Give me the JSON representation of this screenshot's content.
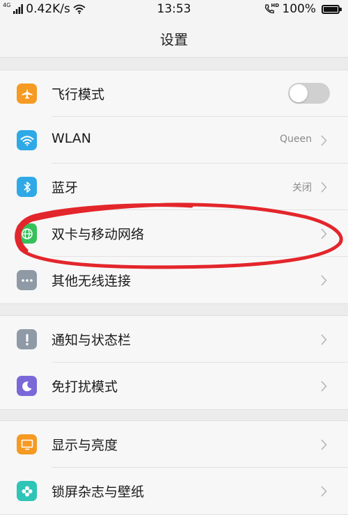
{
  "status_bar": {
    "network_speed": "0.42K/s",
    "signal_tag": "4G",
    "time": "13:53",
    "hd_tag": "HD",
    "battery": "100%",
    "battery_level": 1.0
  },
  "page": {
    "title": "设置"
  },
  "sections": [
    {
      "items": [
        {
          "key": "airplane",
          "label": "飞行模式",
          "icon": "airplane-icon",
          "icon_color": "#f59a23",
          "control": "toggle",
          "toggle_on": false
        },
        {
          "key": "wlan",
          "label": "WLAN",
          "icon": "wifi-icon",
          "icon_color": "#2fa9e6",
          "value": "Queen"
        },
        {
          "key": "bluetooth",
          "label": "蓝牙",
          "icon": "bluetooth-icon",
          "icon_color": "#2fa9e6",
          "value": "关闭"
        },
        {
          "key": "dual-sim",
          "label": "双卡与移动网络",
          "icon": "globe-icon",
          "icon_color": "#35c15a"
        },
        {
          "key": "other-wireless",
          "label": "其他无线连接",
          "icon": "more-dots-icon",
          "icon_color": "#8f9aa6"
        }
      ]
    },
    {
      "items": [
        {
          "key": "notifications",
          "label": "通知与状态栏",
          "icon": "exclamation-icon",
          "icon_color": "#8f9aa6"
        },
        {
          "key": "do-not-disturb",
          "label": "免打扰模式",
          "icon": "moon-icon",
          "icon_color": "#7b68d8"
        }
      ]
    },
    {
      "items": [
        {
          "key": "display",
          "label": "显示与亮度",
          "icon": "monitor-icon",
          "icon_color": "#f59a23"
        },
        {
          "key": "lockscreen",
          "label": "锁屏杂志与壁纸",
          "icon": "flower-icon",
          "icon_color": "#2ec4b6"
        }
      ]
    }
  ],
  "annotation": {
    "color": "#e3262b"
  }
}
